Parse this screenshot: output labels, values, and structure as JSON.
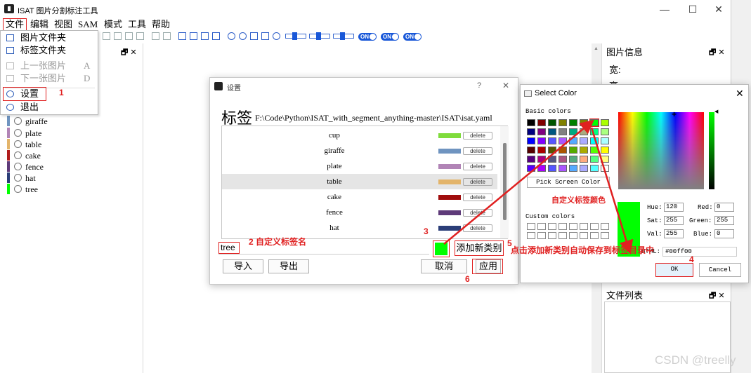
{
  "window": {
    "title": "ISAT 图片分割标注工具",
    "controls": [
      "—",
      "☐",
      "✕"
    ]
  },
  "menubar": [
    "文件",
    "编辑",
    "视图",
    "SAM",
    "模式",
    "工具",
    "帮助"
  ],
  "file_menu": {
    "items": [
      {
        "label": "图片文件夹",
        "key": "",
        "icon": "image-folder-icon",
        "enabled": true
      },
      {
        "label": "标签文件夹",
        "key": "",
        "icon": "label-folder-icon",
        "enabled": true
      },
      {
        "label": "上一张图片",
        "key": "A",
        "icon": "prev-icon",
        "enabled": false
      },
      {
        "label": "下一张图片",
        "key": "D",
        "icon": "next-icon",
        "enabled": false
      },
      {
        "label": "设置",
        "key": "",
        "icon": "settings-icon",
        "enabled": true
      },
      {
        "label": "退出",
        "key": "",
        "icon": "power-icon",
        "enabled": true
      }
    ]
  },
  "toolbar": {
    "switch_labels": [
      "ON",
      "ON",
      "ON"
    ]
  },
  "left_dock": {
    "labels": [
      {
        "name": "giraffe",
        "color": "#6f94c0"
      },
      {
        "name": "plate",
        "color": "#b184b6"
      },
      {
        "name": "table",
        "color": "#e3b46a"
      },
      {
        "name": "cake",
        "color": "#b01c1c"
      },
      {
        "name": "fence",
        "color": "#5e3a79"
      },
      {
        "name": "hat",
        "color": "#2b3e78"
      },
      {
        "name": "tree",
        "color": "#00ff00"
      }
    ]
  },
  "right_dock": {
    "image_info_title": "图片信息",
    "width_label": "宽:",
    "height_label": "高:",
    "file_list_title": "文件列表",
    "dock_buttons": "🗗 ✕"
  },
  "settings_dialog": {
    "title": "设置",
    "help": "?",
    "close": "✕",
    "heading": "标签",
    "config_path": "F:\\Code\\Python\\ISAT_with_segment_anything-master\\ISAT\\isat.yaml",
    "rows": [
      {
        "name": "cup",
        "color": "#7fdc3c",
        "delete": "delete"
      },
      {
        "name": "giraffe",
        "color": "#6f94c0",
        "delete": "delete"
      },
      {
        "name": "plate",
        "color": "#b184b6",
        "delete": "delete"
      },
      {
        "name": "table",
        "color": "#e3b46a",
        "delete": "delete"
      },
      {
        "name": "cake",
        "color": "#a00d0d",
        "delete": "delete"
      },
      {
        "name": "fence",
        "color": "#5e3a79",
        "delete": "delete"
      },
      {
        "name": "hat",
        "color": "#2b3e78",
        "delete": "delete"
      }
    ],
    "selected_row": 3,
    "new_tag_value": "tree",
    "new_tag_color": "#00ff00",
    "add_button": "添加新类别",
    "import_button": "导入",
    "export_button": "导出",
    "cancel_button": "取消",
    "apply_button": "应用"
  },
  "color_dialog": {
    "title": "Select Color",
    "close": "✕",
    "basic_label": "Basic colors",
    "basic_colors": [
      "#000000",
      "#800000",
      "#005500",
      "#808000",
      "#008000",
      "#808000",
      "#00ff00",
      "#aaff00",
      "#000080",
      "#800080",
      "#005580",
      "#808080",
      "#00aa80",
      "#aaaa80",
      "#00ff80",
      "#aaff80",
      "#0000ff",
      "#8000ff",
      "#5555ff",
      "#aa55ff",
      "#55aaff",
      "#aaaaff",
      "#00ffff",
      "#aaffff",
      "#550000",
      "#aa0000",
      "#555500",
      "#aa5500",
      "#55aa00",
      "#aaaa00",
      "#55ff00",
      "#ffff00",
      "#550080",
      "#aa0080",
      "#555580",
      "#aa5580",
      "#55aa80",
      "#ffaa80",
      "#55ff80",
      "#ffff80",
      "#5500ff",
      "#aa00ff",
      "#5555ff",
      "#aa55ff",
      "#55aaff",
      "#aaaaff",
      "#55ffff",
      "#ffffff"
    ],
    "pick_screen": "Pick Screen Color",
    "custom_label": "Custom colors",
    "hue_label": "Hue:",
    "hue": "120",
    "sat_label": "Sat:",
    "sat": "255",
    "val_label": "Val:",
    "val": "255",
    "red_label": "Red:",
    "red": "0",
    "green_label": "Green:",
    "green": "255",
    "blue_label": "Blue:",
    "blue": "0",
    "html_label": "HTML:",
    "html": "#00ff00",
    "ok": "OK",
    "cancel": "Cancel"
  },
  "annotations": {
    "n1": "1",
    "n2": "2 自定义标签名",
    "n3": "3",
    "n4": "4",
    "n5": "5",
    "n5_text": "点击添加新类别自动保存到标签目录中",
    "n6": "6",
    "custom_color": "自定义标签颜色"
  },
  "watermark": "CSDN @treelly"
}
